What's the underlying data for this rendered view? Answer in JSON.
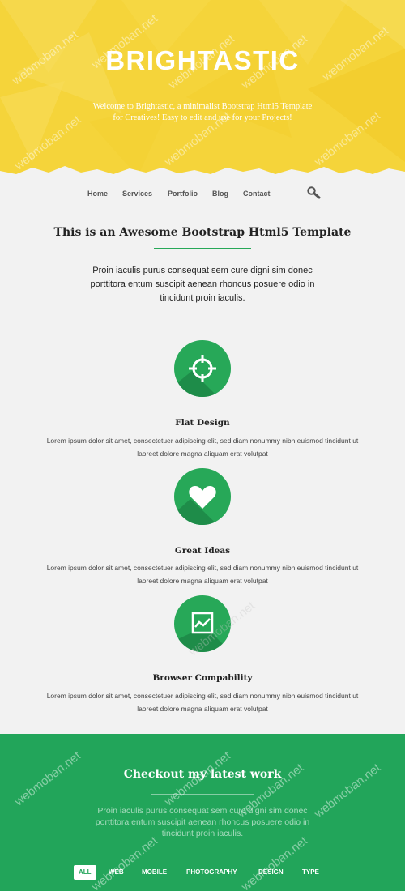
{
  "hero": {
    "title": "BRIGHTASTIC",
    "subtitle": "Welcome to Brightastic, a minimalist Bootstrap Html5 Template for Creatives! Easy to edit and use for your Projects!"
  },
  "nav": {
    "items": [
      "Home",
      "Services",
      "Portfolio",
      "Blog",
      "Contact"
    ],
    "search_icon": "search-icon"
  },
  "intro": {
    "title": "This is an Awesome Bootstrap Html5 Template",
    "text": "Proin iaculis purus consequat sem cure digni sim donec porttitora entum suscipit aenean rhoncus posuere odio in tincidunt proin iaculis."
  },
  "features": [
    {
      "icon": "target-icon",
      "title": "Flat Design",
      "text": "Lorem ipsum dolor sit amet, consectetuer adipiscing elit, sed diam nonummy nibh euismod tincidunt ut laoreet dolore magna aliquam erat volutpat"
    },
    {
      "icon": "heart-icon",
      "title": "Great Ideas",
      "text": "Lorem ipsum dolor sit amet, consectetuer adipiscing elit, sed diam nonummy nibh euismod tincidunt ut laoreet dolore magna aliquam erat volutpat"
    },
    {
      "icon": "chart-icon",
      "title": "Browser Compability",
      "text": "Lorem ipsum dolor sit amet, consectetuer adipiscing elit, sed diam nonummy nibh euismod tincidunt ut laoreet dolore magna aliquam erat volutpat"
    }
  ],
  "portfolio": {
    "title": "Checkout my latest work",
    "text": "Proin iaculis purus consequat sem cure digni sim donec porttitora entum suscipit aenean rhoncus posuere odio in tincidunt proin iaculis.",
    "filters": [
      "ALL",
      "WEB",
      "MOBILE",
      "PHOTOGRAPHY",
      "DESIGN",
      "TYPE"
    ],
    "active_filter": "ALL"
  },
  "watermark": "webmoban.net",
  "colors": {
    "hero_yellow": "#f5d43a",
    "accent_green": "#27a858",
    "portfolio_green": "#22a55a",
    "page_background": "#f2f2f2"
  }
}
